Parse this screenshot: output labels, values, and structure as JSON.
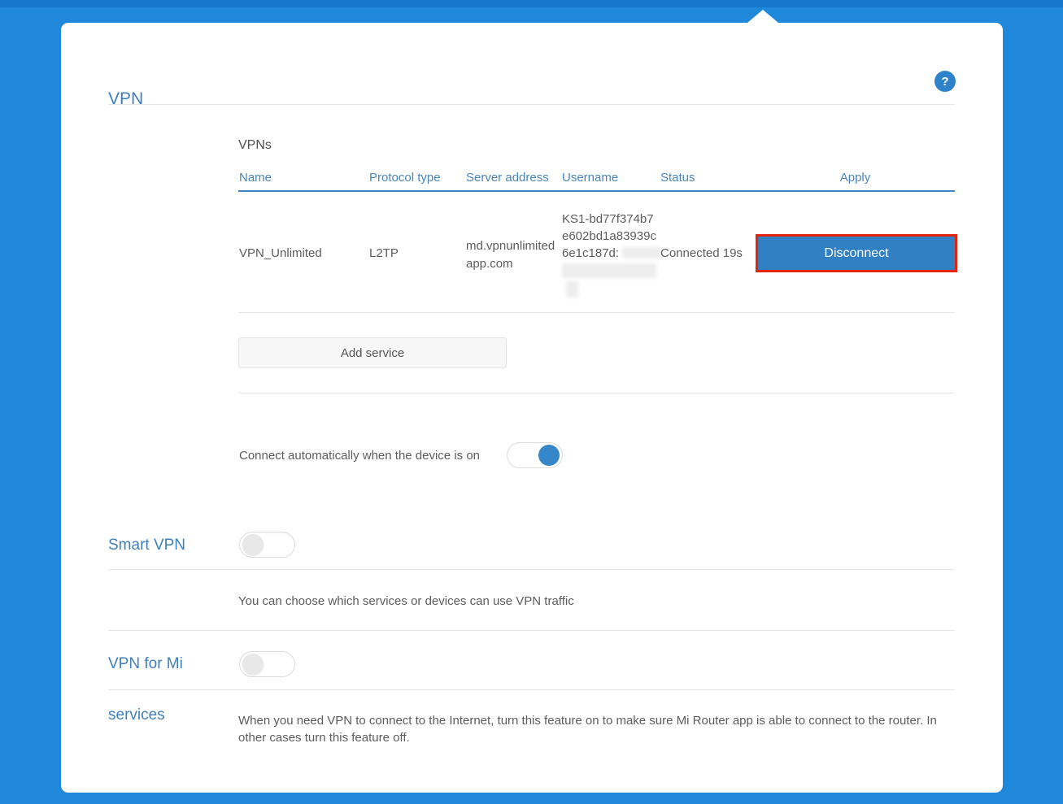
{
  "title": "VPN",
  "help": {
    "glyph": "?"
  },
  "vpns": {
    "section_label": "VPNs",
    "columns": [
      "Name",
      "Protocol type",
      "Server address",
      "Username",
      "Status",
      "Apply"
    ],
    "row": {
      "name": "VPN_Unlimited",
      "protocol_type": "L2TP",
      "server_address": "md.vpnunlimitedapp.com",
      "server_address_lines": [
        "md.vpnunlimited",
        "app.com"
      ],
      "username_visible_lines": [
        "KS1-bd77f374b7",
        "e602bd1a83939c",
        "6e1c187d:"
      ],
      "username_partially_redacted": true,
      "status": "Connected 19s",
      "apply_button": "Disconnect",
      "apply_button_highlighted": true
    },
    "add_service_button": "Add service"
  },
  "auto_connect": {
    "label": "Connect automatically when the device is on",
    "state": "on"
  },
  "smart_vpn": {
    "label": "Smart VPN",
    "state": "off",
    "description": "You can choose which services or devices can use VPN traffic"
  },
  "vpn_for_mi_services": {
    "label_line1": "VPN for Mi",
    "label_line2": "services",
    "state": "off",
    "description": "When you need VPN to connect to the Internet, turn this feature on to make sure Mi Router app is able to connect to the router. In other cases turn this feature off."
  },
  "colors": {
    "background": "#2088da",
    "top_bar": "#1578cd",
    "accent_blue": "#4080ba",
    "header_underline": "#3e86c6",
    "button_blue": "#3180c3",
    "annotation_red": "#e3250f"
  }
}
